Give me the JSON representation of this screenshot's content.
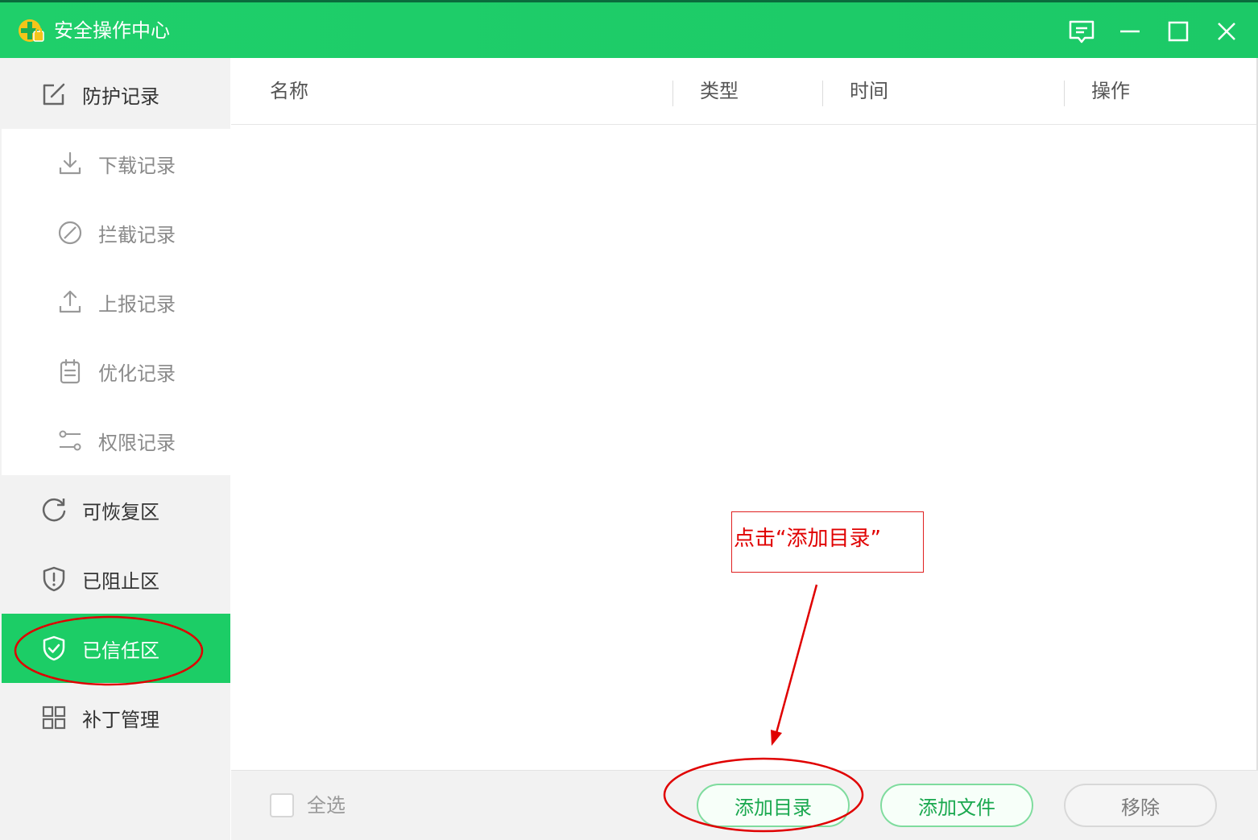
{
  "app": {
    "title": "安全操作中心"
  },
  "colors": {
    "brand": "#1ccd66",
    "annotation": "#e00000"
  },
  "window_controls": [
    {
      "name": "feedback-icon"
    },
    {
      "name": "minimize-icon"
    },
    {
      "name": "maximize-icon"
    },
    {
      "name": "close-icon"
    }
  ],
  "sidebar": {
    "protect": {
      "label": "防护记录",
      "icon": "edit-icon"
    },
    "records": [
      {
        "label": "下载记录",
        "icon": "download-icon"
      },
      {
        "label": "拦截记录",
        "icon": "block-icon"
      },
      {
        "label": "上报记录",
        "icon": "upload-icon"
      },
      {
        "label": "优化记录",
        "icon": "clipboard-icon"
      },
      {
        "label": "权限记录",
        "icon": "slider-icon"
      }
    ],
    "groups": [
      {
        "label": "可恢复区",
        "icon": "refresh-icon"
      },
      {
        "label": "已阻止区",
        "icon": "shield-alert-icon"
      },
      {
        "label": "已信任区",
        "icon": "shield-check-icon",
        "active": true
      },
      {
        "label": "补丁管理",
        "icon": "grid-icon"
      }
    ]
  },
  "table": {
    "columns": [
      "名称",
      "类型",
      "时间",
      "操作"
    ],
    "rows": []
  },
  "footer": {
    "select_all": "全选",
    "add_dir": "添加目录",
    "add_file": "添加文件",
    "remove": "移除"
  },
  "annotation": {
    "text": "点击“添加目录”"
  }
}
